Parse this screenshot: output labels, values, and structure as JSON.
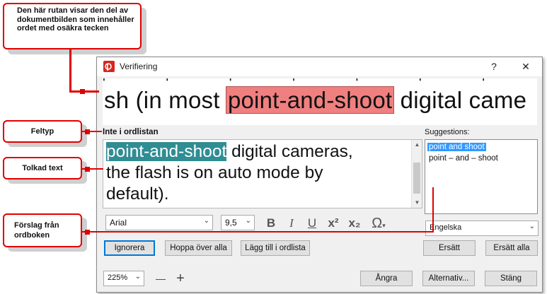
{
  "window": {
    "title": "Verifiering",
    "help_glyph": "?",
    "close_glyph": "✕"
  },
  "image_preview": {
    "before": "sh (in most ",
    "highlight": "point-and-shoot",
    "after": " digital came"
  },
  "error_type": "Inte i ordlistan",
  "editor": {
    "selected_word": "point-and-shoot",
    "rest_line1": " digital cameras,",
    "line2": "the flash is on auto mode by",
    "line3": "default)."
  },
  "suggestions": {
    "label": "Suggestions:",
    "items": [
      "point and shoot",
      "point – and – shoot"
    ],
    "selected_index": 0
  },
  "language": "Engelska",
  "format_bar": {
    "font": "Arial",
    "size": "9,5",
    "bold": "B",
    "italic": "I",
    "underline": "U",
    "superscript": "x²",
    "subscript": "x₂",
    "special_char": "Ω"
  },
  "buttons": {
    "ignore": "Ignorera",
    "skip_all": "Hoppa över alla",
    "add_to_dict": "Lägg till i ordlista",
    "replace": "Ersätt",
    "replace_all": "Ersätt alla",
    "undo": "Ångra",
    "options": "Alternativ...",
    "close": "Stäng"
  },
  "zoom": {
    "value": "225%",
    "minus": "—",
    "plus": "+"
  },
  "callouts": {
    "image": "Den här rutan visar den del av dokumentbilden som innehåller ordet med osäkra tecken",
    "error_type": "Feltyp",
    "recognized": "Tolkad text",
    "suggestions": "Förslag från ordboken"
  },
  "colors": {
    "callout_border": "#e00000",
    "highlight": "#f08080",
    "selection": "#2f8d93",
    "suggestion_selected": "#3399ff"
  }
}
